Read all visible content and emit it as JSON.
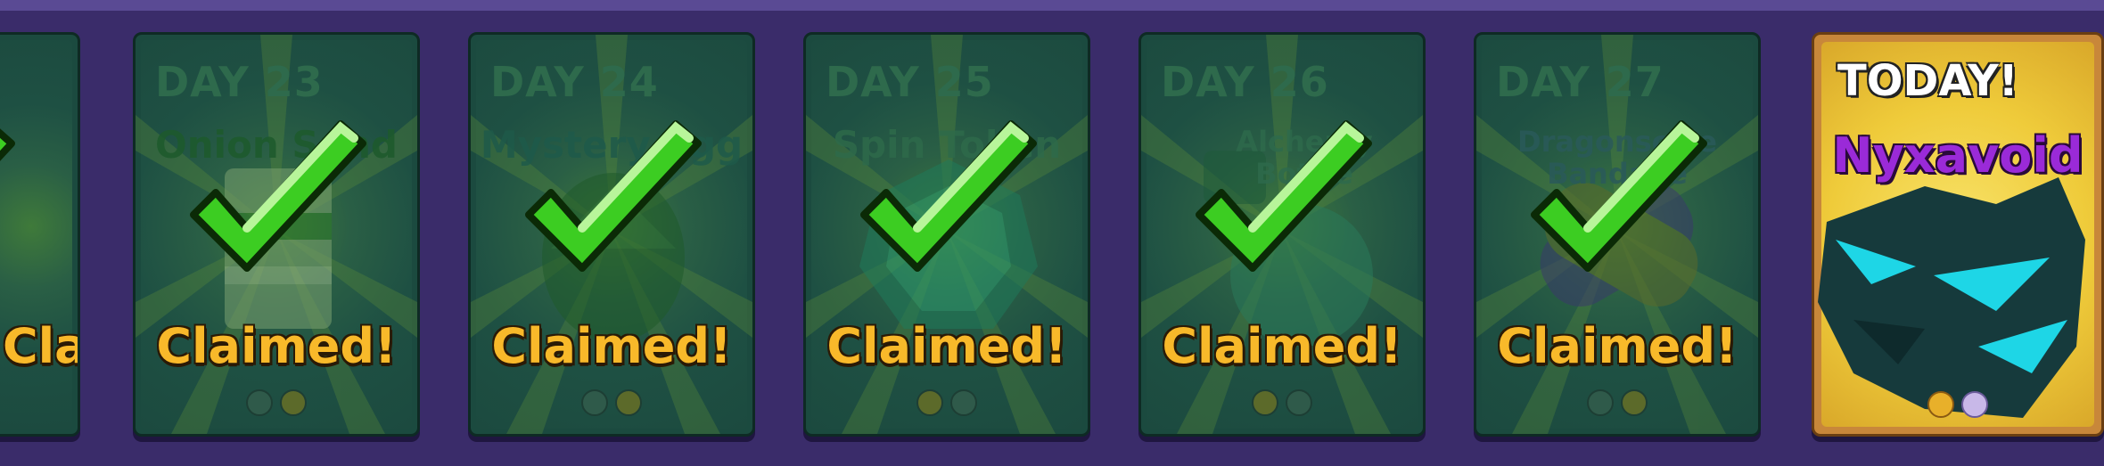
{
  "cards": [
    {
      "day": "",
      "reward": "",
      "status": "Claimed!",
      "partial": true
    },
    {
      "day": "DAY 23",
      "reward": "Onion Sand",
      "status": "Claimed!",
      "art": "onion-sandwich"
    },
    {
      "day": "DAY 24",
      "reward": "Mystery Egg",
      "status": "Claimed!",
      "art": "mystery-egg"
    },
    {
      "day": "DAY 25",
      "reward": "Spin Token",
      "status": "Claimed!",
      "art": "spin-token"
    },
    {
      "day": "DAY 26",
      "reward": "Alchemy Bottle",
      "status": "Claimed!",
      "art": "alchemy-bottle"
    },
    {
      "day": "DAY 27",
      "reward": "Dragonscale Bandage",
      "status": "Claimed!",
      "art": "dragon-bandage"
    }
  ],
  "today": {
    "label": "TODAY!",
    "reward": "Nyxavoid",
    "art": "dragon-pet"
  },
  "colors": {
    "claimed": "#f8b92a",
    "today_name": "#9a2ad8",
    "card_bg": "#1b4a3f",
    "check": "#3ccd22"
  },
  "icons": [
    "checkmark-icon",
    "dragon-icon"
  ]
}
